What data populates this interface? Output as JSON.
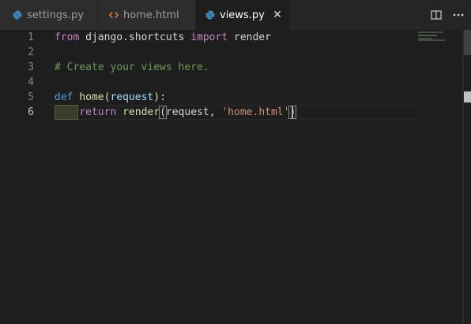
{
  "tabs": [
    {
      "label": "settings.py",
      "icon": "python-icon",
      "active": false
    },
    {
      "label": "home.html",
      "icon": "html-icon",
      "active": false
    },
    {
      "label": "views.py",
      "icon": "python-icon",
      "active": true
    }
  ],
  "actions": [
    {
      "name": "split-editor-icon",
      "glyph": ""
    },
    {
      "name": "more-actions-icon",
      "glyph": "···"
    }
  ],
  "close_glyph": "✕",
  "line_numbers": [
    "1",
    "2",
    "3",
    "4",
    "5",
    "6"
  ],
  "code": {
    "line1": {
      "kw": "from",
      "text1": " django.shortcuts ",
      "kw2": "import",
      "text2": " render"
    },
    "line3": {
      "comment": "# Create your views here."
    },
    "line5": {
      "kw": "def",
      "fn": "home",
      "open": "(",
      "param": "request",
      "close": "):"
    },
    "line6": {
      "indent": "    ",
      "kw": "return",
      "fn": " render",
      "open": "(",
      "param": "request, ",
      "str": "'home.html'",
      "close": ")"
    }
  },
  "colors": {
    "editor_bg": "#1e1e1e",
    "keyword": "#569cd6",
    "control_keyword": "#c586c0",
    "comment": "#6a9955",
    "function": "#dcdcaa",
    "string": "#ce9178",
    "python_icon": "#3c87b7",
    "html_icon": "#e37933"
  }
}
